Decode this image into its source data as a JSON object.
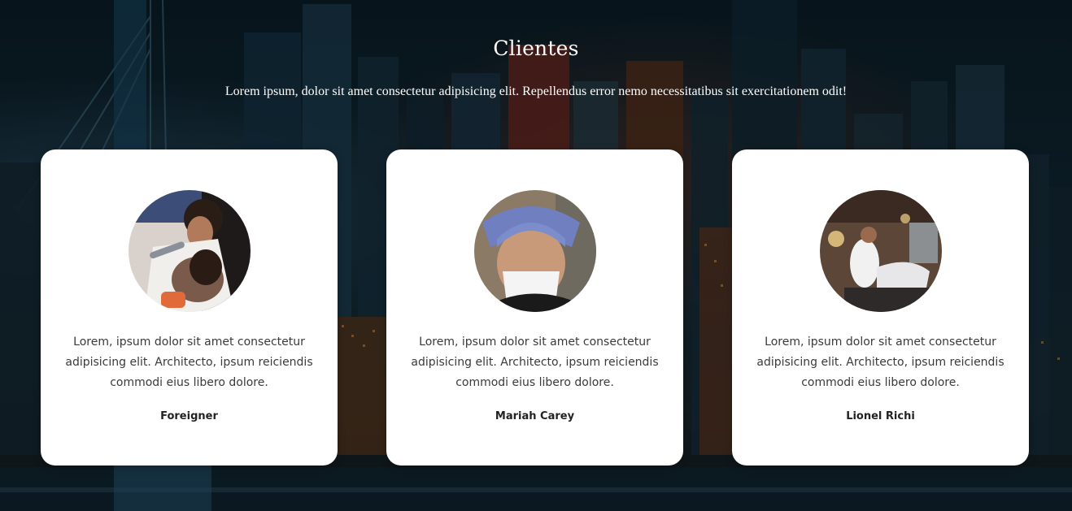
{
  "section": {
    "title": "Clientes",
    "subtitle": "Lorem ipsum, dolor sit amet consectetur adipisicing elit. Repellendus error nemo necessitatibus sit exercitationem odit!"
  },
  "testimonials": [
    {
      "quote": "Lorem, ipsum dolor sit amet consectetur adipisicing elit. Architecto, ipsum reiciendis commodi eius libero dolore.",
      "name": "Foreigner",
      "photo": "barber-trimming-beard-photo"
    },
    {
      "quote": "Lorem, ipsum dolor sit amet consectetur adipisicing elit. Architecto, ipsum reiciendis commodi eius libero dolore.",
      "name": "Mariah Carey",
      "photo": "blue-fade-haircut-photo"
    },
    {
      "quote": "Lorem, ipsum dolor sit amet consectetur adipisicing elit. Architecto, ipsum reiciendis commodi eius libero dolore.",
      "name": "Lionel Richi",
      "photo": "barbershop-interior-photo"
    }
  ],
  "colors": {
    "card_background": "#ffffff",
    "text_light": "#ffffff",
    "text_dark": "#3a3a3a"
  }
}
